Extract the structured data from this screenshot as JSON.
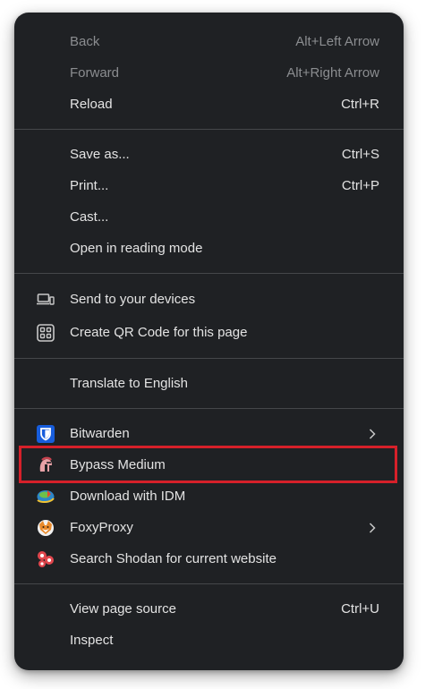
{
  "menu": {
    "items": [
      {
        "label": "Back",
        "shortcut": "Alt+Left Arrow"
      },
      {
        "label": "Forward",
        "shortcut": "Alt+Right Arrow"
      },
      {
        "label": "Reload",
        "shortcut": "Ctrl+R"
      },
      {
        "label": "Save as...",
        "shortcut": "Ctrl+S"
      },
      {
        "label": "Print...",
        "shortcut": "Ctrl+P"
      },
      {
        "label": "Cast..."
      },
      {
        "label": "Open in reading mode"
      },
      {
        "label": "Send to your devices",
        "icon": "devices-icon"
      },
      {
        "label": "Create QR Code for this page",
        "icon": "qr-code-icon"
      },
      {
        "label": "Translate to English"
      },
      {
        "label": "Bitwarden",
        "icon": "bitwarden-icon"
      },
      {
        "label": "Bypass Medium",
        "icon": "spartan-helmet-icon"
      },
      {
        "label": "Download with IDM",
        "icon": "idm-icon"
      },
      {
        "label": "FoxyProxy",
        "icon": "foxyproxy-icon"
      },
      {
        "label": "Search Shodan for current website",
        "icon": "shodan-icon"
      },
      {
        "label": "View page source",
        "shortcut": "Ctrl+U"
      },
      {
        "label": "Inspect"
      }
    ]
  },
  "colors": {
    "menu_bg": "#1f2124",
    "text": "#e3e3e3",
    "disabled_text": "#8b8d90",
    "separator": "#45474a",
    "highlight": "#d6202a"
  }
}
